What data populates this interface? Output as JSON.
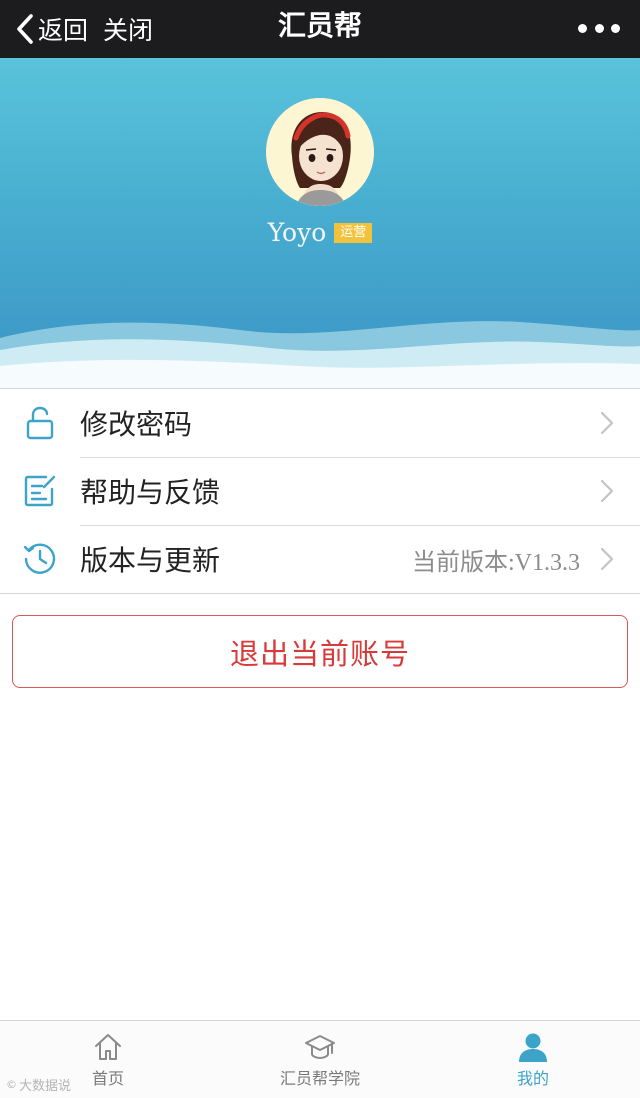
{
  "navbar": {
    "back_label": "返回",
    "close_label": "关闭",
    "title": "汇员帮"
  },
  "profile": {
    "name": "Yoyo",
    "badge": "运营"
  },
  "menu": {
    "items": [
      {
        "label": "修改密码",
        "icon": "unlock-icon"
      },
      {
        "label": "帮助与反馈",
        "icon": "edit-note-icon"
      },
      {
        "label": "版本与更新",
        "icon": "history-icon",
        "value": "当前版本:V1.3.3"
      }
    ]
  },
  "logout_label": "退出当前账号",
  "tabbar": {
    "tabs": [
      {
        "label": "首页",
        "icon": "home-icon"
      },
      {
        "label": "汇员帮学院",
        "icon": "graduation-cap-icon"
      },
      {
        "label": "我的",
        "icon": "user-icon",
        "active": true
      }
    ]
  },
  "watermark": "大数据说",
  "colors": {
    "accent": "#3ca3c9",
    "logout": "#d83a3a",
    "badge": "#f2c33a",
    "navbar": "#1c1c1e"
  }
}
